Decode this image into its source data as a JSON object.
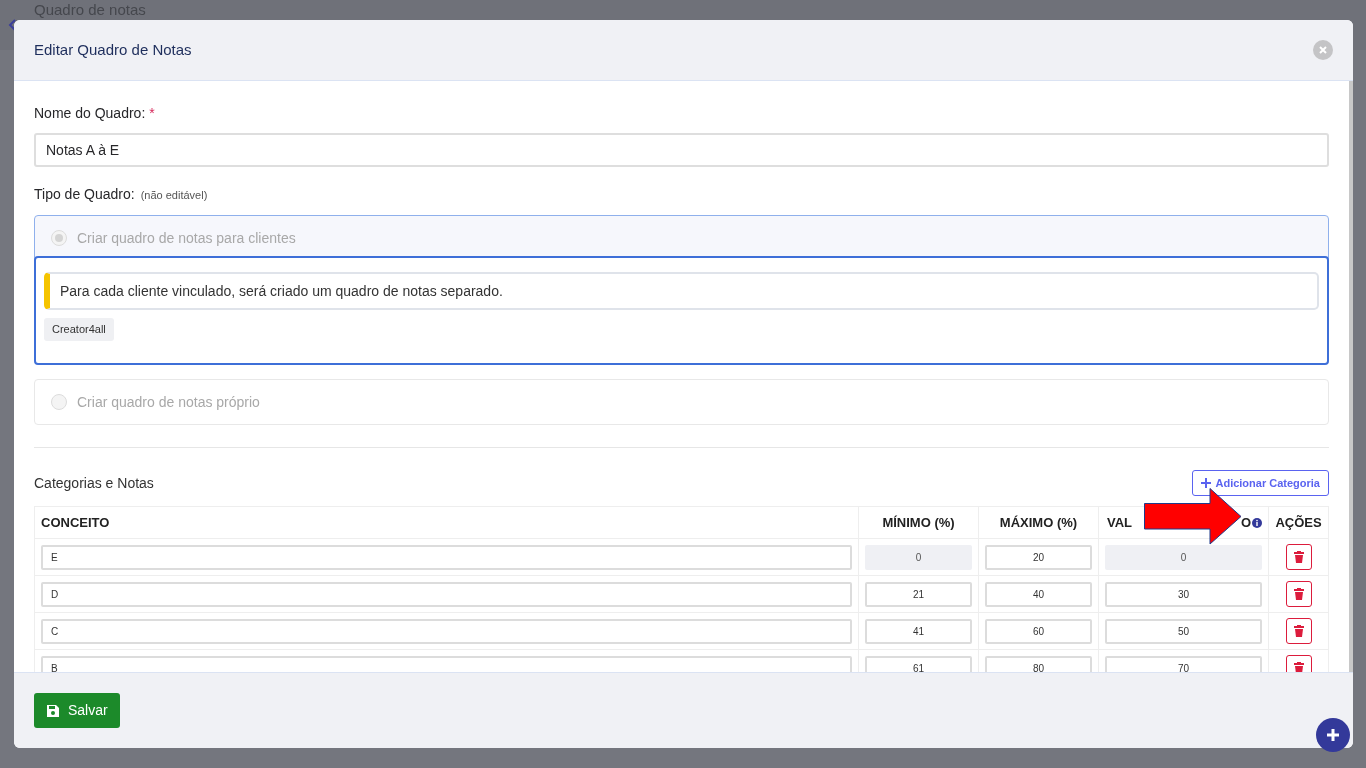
{
  "background_page": {
    "title": "Quadro de notas"
  },
  "modal": {
    "title": "Editar Quadro de Notas"
  },
  "form": {
    "name_label": "Nome do Quadro:",
    "required_mark": "*",
    "name_value": "Notas A à E",
    "type_label": "Tipo de Quadro:",
    "type_hint": "(não editável)"
  },
  "type_options": [
    {
      "label": "Criar quadro de notas para clientes",
      "selected": true,
      "disabled": true,
      "expanded": true,
      "notice": "Para cada cliente vinculado, será criado um quadro de notas separado.",
      "tags": [
        "Creator4all"
      ]
    },
    {
      "label": "Criar quadro de notas próprio",
      "selected": false,
      "disabled": true,
      "expanded": false
    }
  ],
  "categories": {
    "title": "Categorias e Notas",
    "add_button": "Adicionar Categoria",
    "columns": [
      {
        "label": "CONCEITO",
        "kind": "text"
      },
      {
        "label": "MÍNIMO (%)",
        "kind": "text"
      },
      {
        "label": "MÁXIMO (%)",
        "kind": "text"
      },
      {
        "label_start": "VAL",
        "label_end": "O",
        "kind": "covered"
      },
      {
        "label": "AÇÕES",
        "kind": "text"
      }
    ],
    "rows": [
      {
        "concept": "E",
        "min": "0",
        "max": "20",
        "value": "0",
        "locked": true
      },
      {
        "concept": "D",
        "min": "21",
        "max": "40",
        "value": "30",
        "locked": false
      },
      {
        "concept": "C",
        "min": "41",
        "max": "60",
        "value": "50",
        "locked": false
      },
      {
        "concept": "B",
        "min": "61",
        "max": "80",
        "value": "70",
        "locked": false
      }
    ]
  },
  "footer": {
    "save_button": "Salvar"
  }
}
